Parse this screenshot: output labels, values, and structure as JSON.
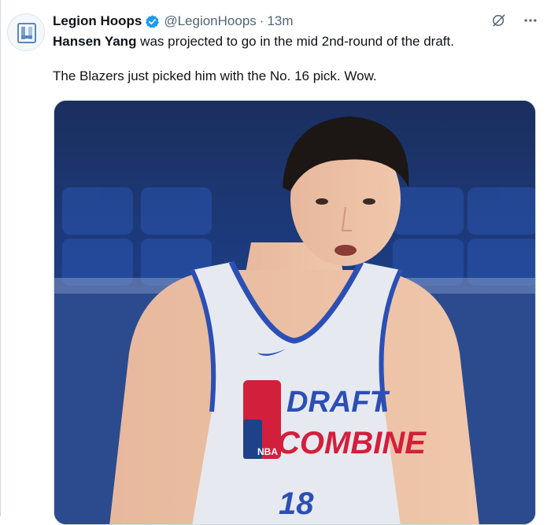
{
  "tweet": {
    "author_name": "Legion Hoops",
    "handle": "@LegionHoops",
    "separator": "·",
    "time": "13m",
    "avatar_text": "LH",
    "text_bold": "Hansen Yang",
    "text_line1_rest": " was projected to go in the mid 2nd-round of the draft.",
    "text_line2": "The Blazers just picked him with the No. 16 pick. Wow."
  },
  "actions": {
    "grok_icon": "grok-icon",
    "more_icon": "more-icon",
    "more_label": "···"
  },
  "media": {
    "jersey_line1": "DRAFT",
    "jersey_line2": "COMBINE",
    "logo_text": "NBA",
    "jersey_number": "18"
  },
  "colors": {
    "verified": "#1d9bf0",
    "text_secondary": "#536471",
    "court_blue": "#1b3f8a",
    "jersey_red": "#d21f3c"
  }
}
